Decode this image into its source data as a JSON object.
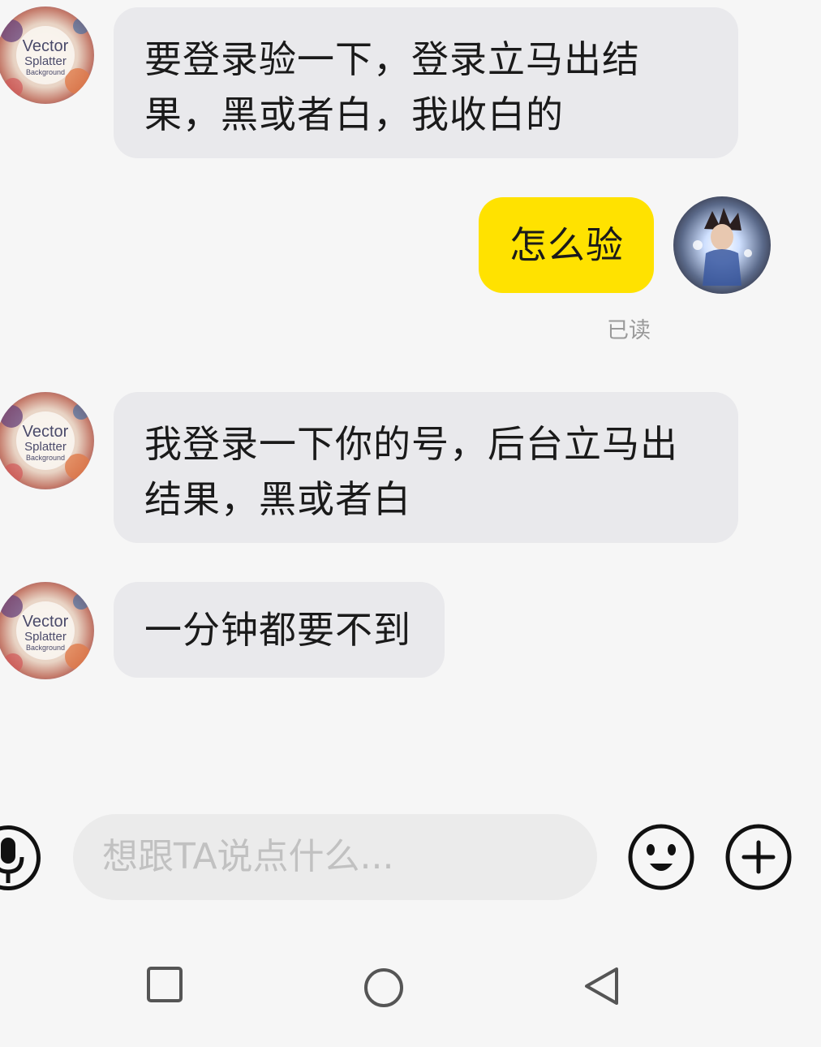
{
  "messages": [
    {
      "id": "m1",
      "direction": "incoming",
      "text_lines": [
        "要登录验一下，登录立马出结",
        "果，黑或者白，我收白的"
      ],
      "avatar_text": [
        "Vector",
        "Splatter",
        "Background"
      ]
    },
    {
      "id": "m2",
      "direction": "outgoing",
      "text_lines": [
        "怎么验"
      ],
      "status": "已读"
    },
    {
      "id": "m3",
      "direction": "incoming",
      "text_lines": [
        "我登录一下你的号，后台立马出",
        "结果，黑或者白"
      ],
      "avatar_text": [
        "Vector",
        "Splatter",
        "Background"
      ]
    },
    {
      "id": "m4",
      "direction": "incoming",
      "text_lines": [
        "一分钟都要不到"
      ],
      "avatar_text": [
        "Vector",
        "Splatter",
        "Background"
      ]
    }
  ],
  "input": {
    "placeholder": "想跟TA说点什么...",
    "icons": [
      "microphone-icon",
      "emoji-icon",
      "plus-icon"
    ]
  },
  "nav": {
    "icons": [
      "recent-apps-icon",
      "home-icon",
      "back-icon"
    ]
  },
  "colors": {
    "incoming_bubble": "#e9e9ec",
    "outgoing_bubble": "#ffe200",
    "background": "#f6f6f6"
  }
}
